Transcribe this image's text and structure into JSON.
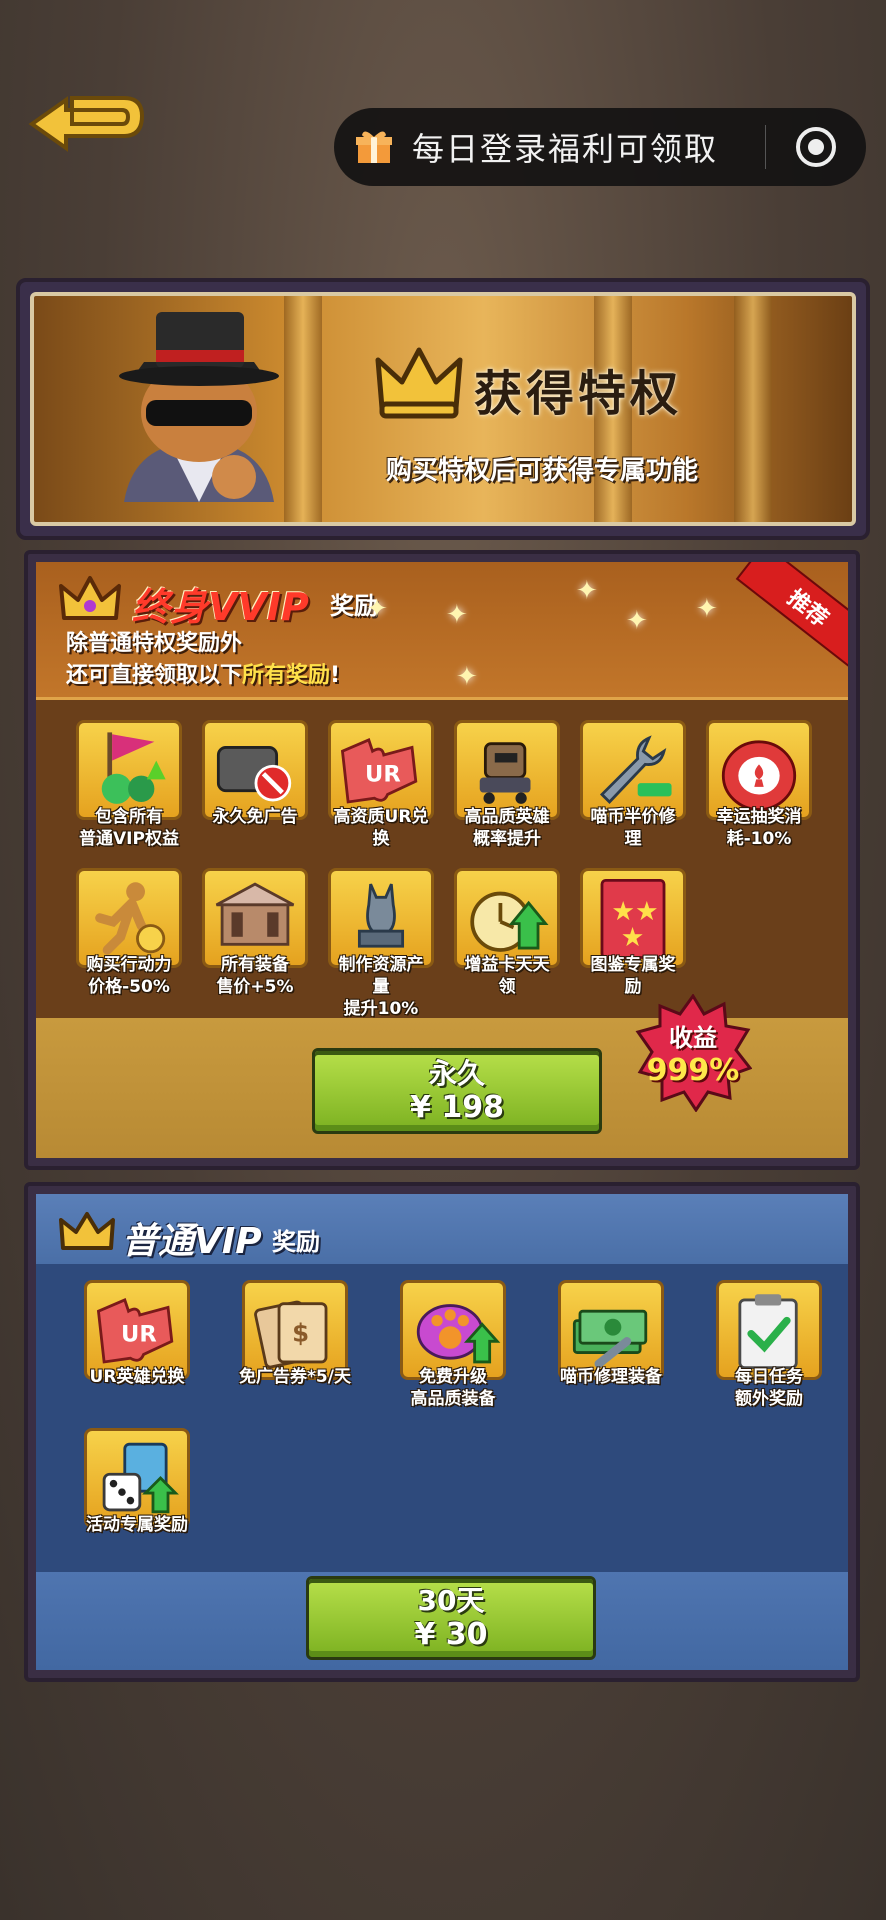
{
  "topbar": {
    "title": "每日登录福利可领取"
  },
  "banner": {
    "title": "获得特权",
    "subtitle": "购买特权后可获得专属功能"
  },
  "vvip": {
    "title": "终身VVIP",
    "title_suffix": "奖励",
    "ribbon": "推荐",
    "desc_line1": "除普通特权奖励外",
    "desc_line2_prefix": "还可直接领取以下",
    "desc_line2_highlight": "所有奖励",
    "desc_line2_suffix": "!",
    "items": [
      {
        "line1": "包含所有",
        "line2": "普通VIP权益",
        "line3": "",
        "icon": "flag-gems-icon"
      },
      {
        "line1": "永久免广告",
        "line2": "",
        "line3": "",
        "icon": "no-ads-icon"
      },
      {
        "line1": "高资质UR兑",
        "line2": "换",
        "line3": "",
        "icon": "puzzle-ur-icon"
      },
      {
        "line1": "高品质英雄",
        "line2": "概率提升",
        "line3": "",
        "icon": "hero-robot-icon"
      },
      {
        "line1": "喵币半价修",
        "line2": "理",
        "line3": "",
        "icon": "wrench-icon"
      },
      {
        "line1": "幸运抽奖消",
        "line2": "耗-10%",
        "line3": "",
        "icon": "casino-chip-icon"
      },
      {
        "line1": "购买行动力",
        "line2": "价格-50%",
        "line3": "",
        "icon": "runner-icon"
      },
      {
        "line1": "所有装备",
        "line2": "售价+5%",
        "line3": "",
        "icon": "carousel-icon"
      },
      {
        "line1": "制作资源产",
        "line2": "量",
        "line3": "提升10%",
        "icon": "statue-icon"
      },
      {
        "line1": "增益卡天天",
        "line2": "领",
        "line3": "",
        "icon": "timer-boost-icon"
      },
      {
        "line1": "图鉴专属奖",
        "line2": "励",
        "line3": "",
        "icon": "stars-card-icon"
      }
    ],
    "button": {
      "line1": "永久",
      "line2": "¥ 198"
    },
    "burst": {
      "line1": "收益",
      "line2": "999%"
    }
  },
  "vip": {
    "title": "普通VIP",
    "title_suffix": "奖励",
    "items": [
      {
        "line1": "UR英雄兑换",
        "line2": "",
        "icon": "puzzle-ur-icon"
      },
      {
        "line1": "免广告券*5/天",
        "line2": "",
        "icon": "ticket-cards-icon"
      },
      {
        "line1": "免费升级",
        "line2": "高品质装备",
        "icon": "paw-upgrade-icon"
      },
      {
        "line1": "喵币修理装备",
        "line2": "",
        "icon": "money-wrench-icon"
      },
      {
        "line1": "每日任务",
        "line2": "额外奖励",
        "icon": "clipboard-check-icon"
      },
      {
        "line1": "活动专属奖励",
        "line2": "",
        "icon": "dice-cards-icon"
      }
    ],
    "button": {
      "line1": "30天",
      "line2": "¥ 30"
    }
  },
  "colors": {
    "gold": "#f2c23a",
    "green_button": "#8cc22a",
    "vvip_title": "#ff3a2a",
    "panel_blue": "#2e4a7c"
  }
}
